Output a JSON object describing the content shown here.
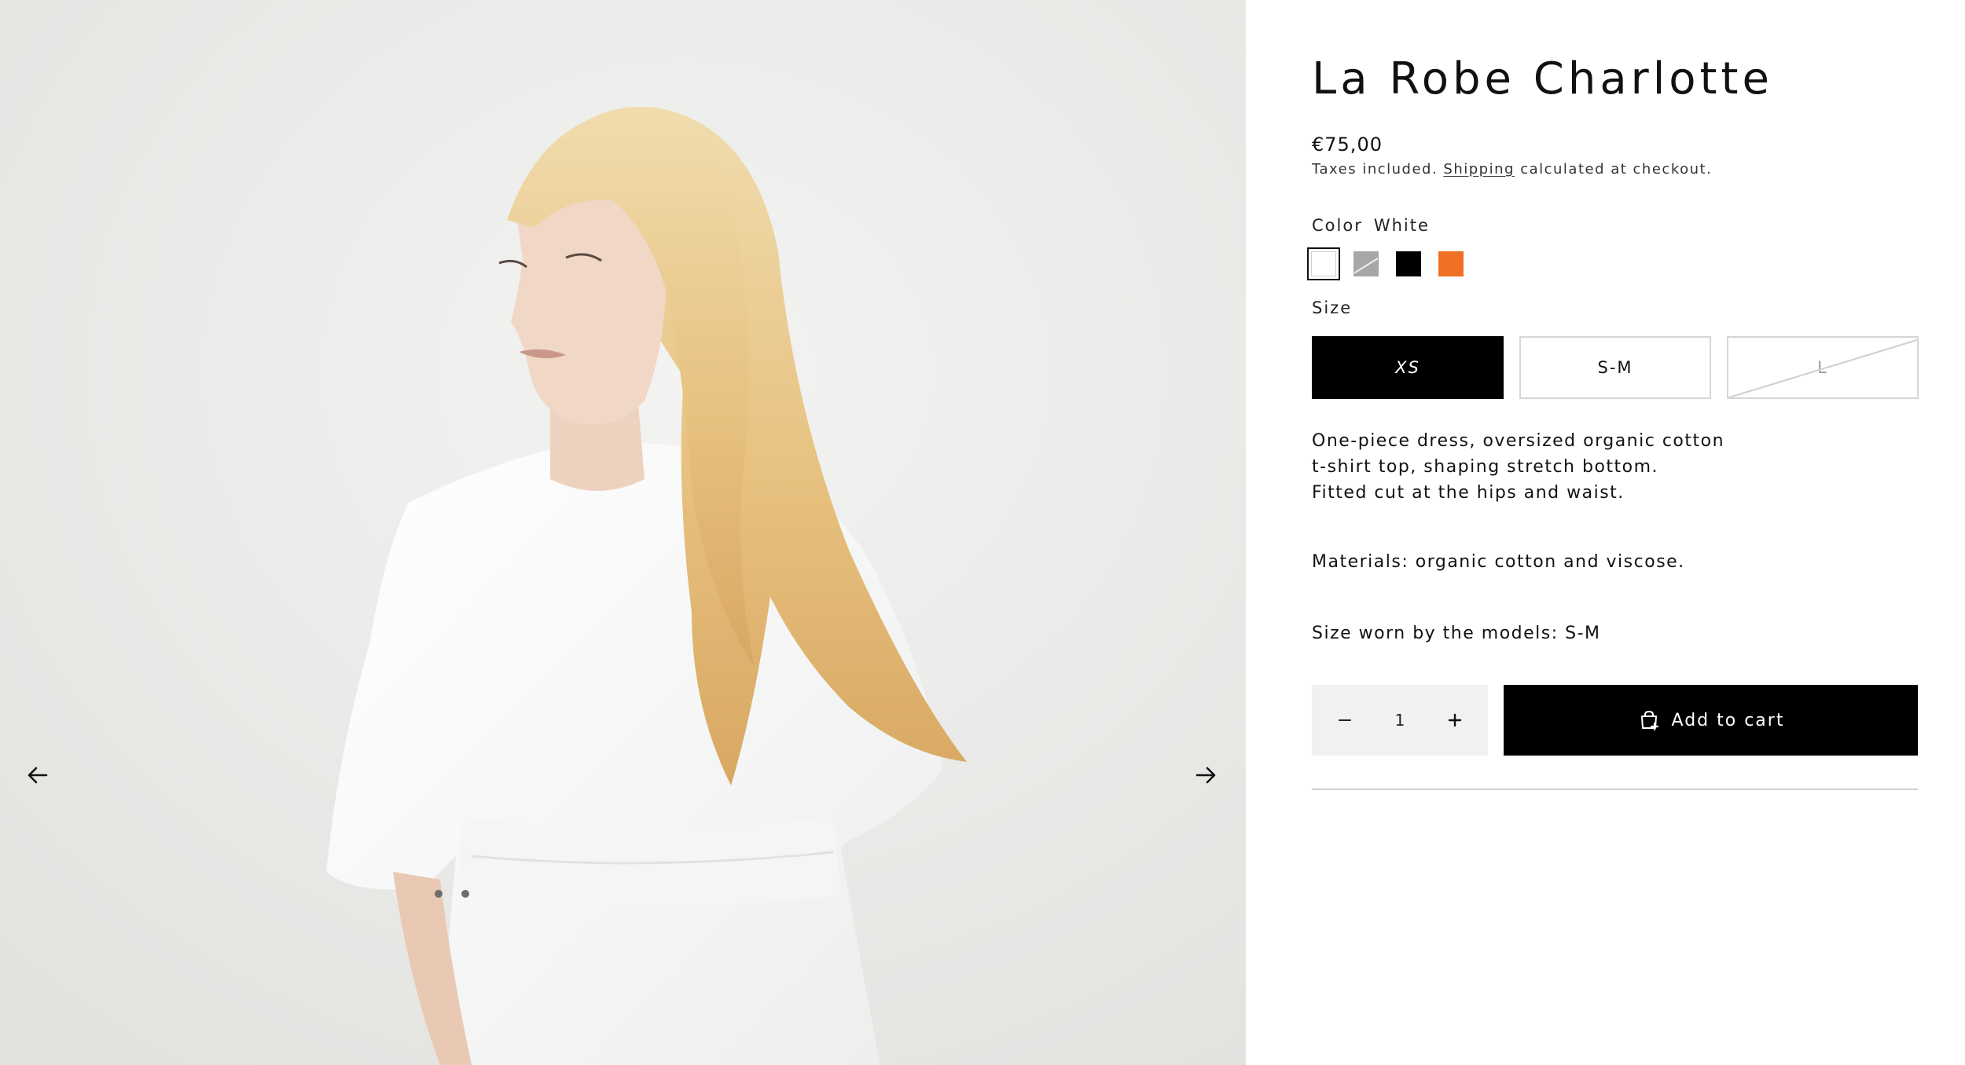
{
  "product": {
    "title": "La Robe Charlotte",
    "price": "€75,00",
    "tax_note_prefix": "Taxes included.",
    "tax_note_link": "Shipping",
    "tax_note_suffix": "calculated at checkout."
  },
  "gallery": {
    "prev_icon": "arrow-left-icon",
    "next_icon": "arrow-right-icon"
  },
  "color": {
    "label": "Color",
    "selected": "White",
    "swatches": [
      {
        "name": "White",
        "hex": "#ffffff",
        "state": "selected"
      },
      {
        "name": "Grey",
        "hex": "#a7a7a7",
        "state": "sold-out"
      },
      {
        "name": "Black",
        "hex": "#000000",
        "state": "available"
      },
      {
        "name": "Orange",
        "hex": "#ef7022",
        "state": "available"
      }
    ]
  },
  "size": {
    "label": "Size",
    "options": [
      {
        "label": "XS",
        "state": "selected"
      },
      {
        "label": "S-M",
        "state": "available"
      },
      {
        "label": "L",
        "state": "sold-out"
      }
    ]
  },
  "description": {
    "line1": "One-piece dress, oversized organic cotton",
    "line2": "t-shirt top, shaping stretch bottom.",
    "line3": "Fitted cut at the hips and waist.",
    "materials": "Materials: organic cotton and viscose.",
    "models_size": "Size worn by the models: S-M"
  },
  "cart": {
    "quantity": "1",
    "decrease_icon": "minus-icon",
    "increase_icon": "plus-icon",
    "add_label": "Add to cart",
    "add_icon": "shopping-bag-plus-icon"
  },
  "colors": {
    "accent": "#000000",
    "qty_bg": "#f1f1f1",
    "border": "#d6d6d6"
  }
}
